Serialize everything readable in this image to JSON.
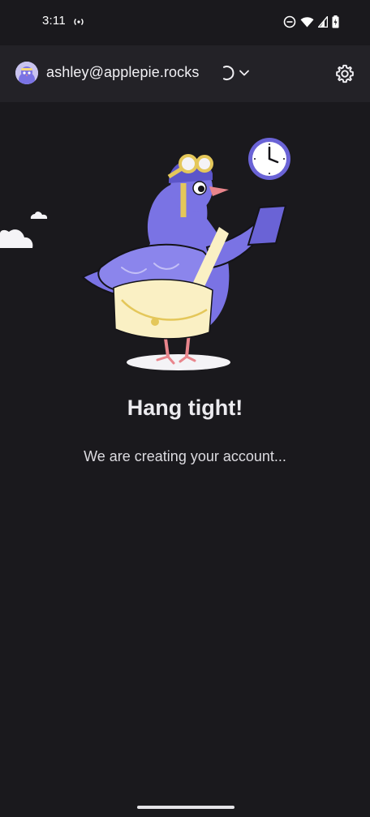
{
  "status_bar": {
    "time": "3:11"
  },
  "header": {
    "account_email": "ashley@applepie.rocks",
    "icons": [
      "avatar",
      "loading-spinner-icon",
      "chevron-down-icon",
      "gear-icon"
    ]
  },
  "main": {
    "headline": "Hang tight!",
    "message": "We are creating your account..."
  },
  "colors": {
    "background": "#1a191d",
    "header_background": "#232227",
    "pigeon": "#7a73e4",
    "bag": "#faf0c4"
  }
}
